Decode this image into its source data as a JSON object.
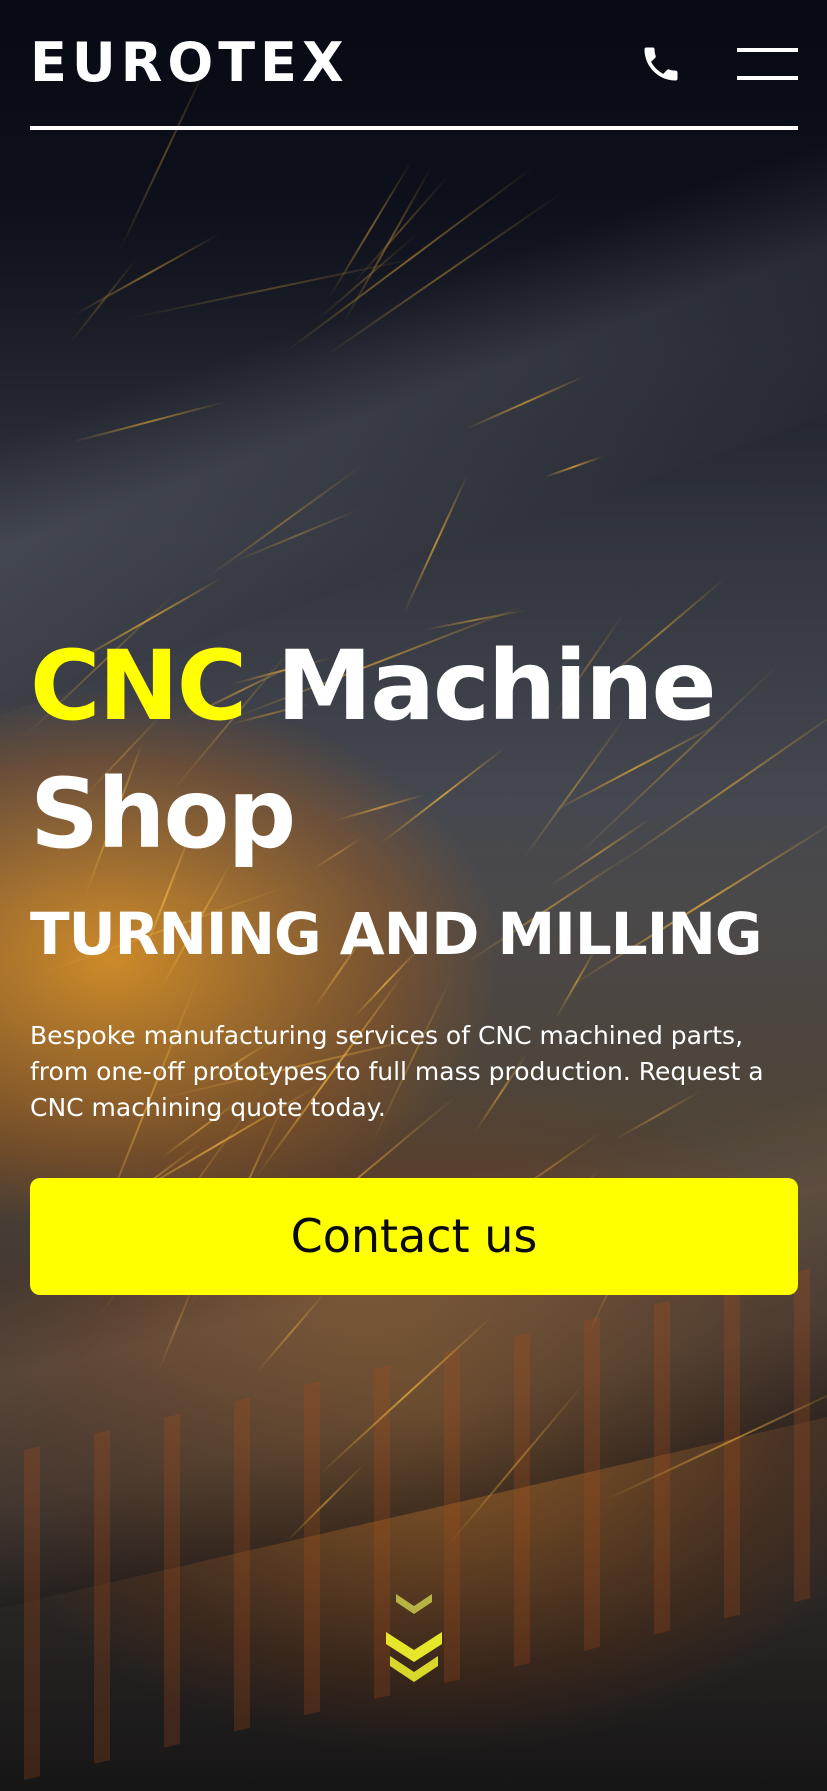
{
  "header": {
    "logo": "EUROTEX",
    "phone_icon": "phone-icon",
    "menu_icon": "hamburger-menu-icon"
  },
  "hero": {
    "title_accent": "CNC",
    "title_rest": "Machine Shop",
    "subtitle": "TURNING AND MILLING",
    "description": "Bespoke manufacturing services of CNC machined parts, from one-off prototypes to full mass production. Request a CNC machining quote today.",
    "cta_label": "Contact us",
    "scroll_icon": "chevrons-down-icon"
  },
  "colors": {
    "accent": "#ffff00",
    "text": "#ffffff",
    "cta_text": "#0b0b0b"
  }
}
